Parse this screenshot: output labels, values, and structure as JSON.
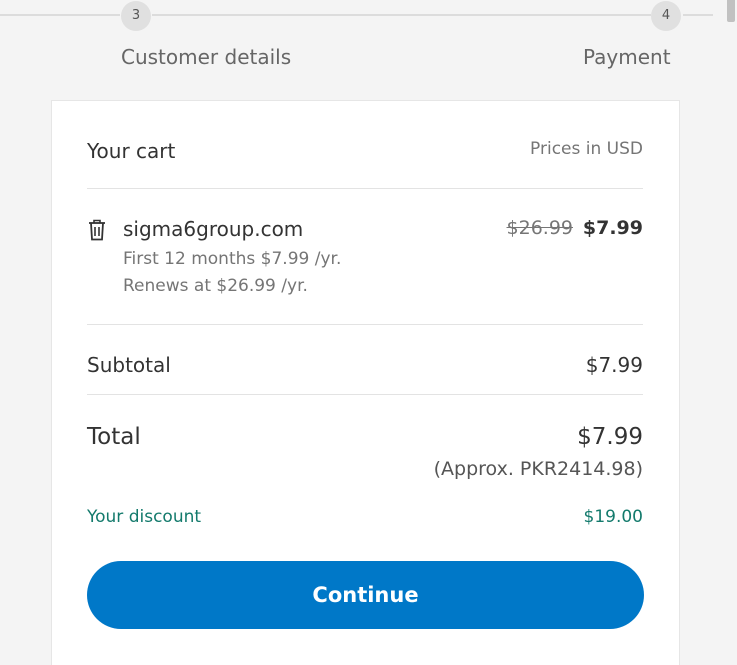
{
  "stepper": {
    "step3": {
      "number": "3",
      "label": "Customer details"
    },
    "step4": {
      "number": "4",
      "label": "Payment"
    }
  },
  "cart": {
    "title": "Your cart",
    "currency_note": "Prices in USD",
    "item": {
      "icon": "trash-icon",
      "domain": "sigma6group.com",
      "term_line1": "First 12 months $7.99 /yr.",
      "term_line2": "Renews at $26.99 /yr.",
      "old_price": "$26.99",
      "price": "$7.99"
    },
    "subtotal": {
      "label": "Subtotal",
      "value": "$7.99"
    },
    "total": {
      "label": "Total",
      "value": "$7.99",
      "approx": "(Approx. PKR2414.98)"
    },
    "discount": {
      "label": "Your discount",
      "value": "$19.00"
    },
    "continue_label": "Continue"
  },
  "colors": {
    "primary_button": "#0078c8",
    "discount_text": "#137a6c",
    "background": "#f4f4f4"
  }
}
